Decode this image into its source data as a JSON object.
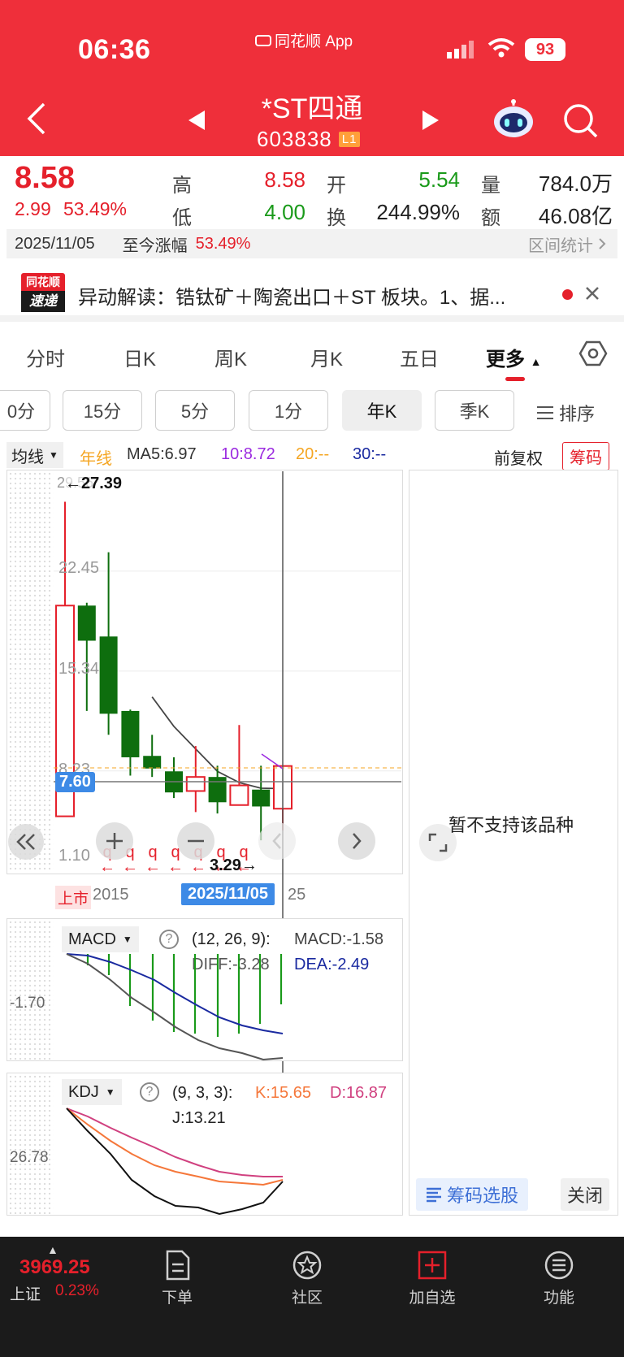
{
  "status": {
    "time": "06:36",
    "app": "同花顺 App",
    "battery": "93"
  },
  "stock": {
    "name": "*ST四通",
    "code": "603838",
    "level": "L1"
  },
  "quote": {
    "price": "8.58",
    "change": "2.99",
    "change_pct": "53.49%",
    "high_label": "高",
    "high": "8.58",
    "low_label": "低",
    "low": "4.00",
    "open_label": "开",
    "open": "5.54",
    "turnover_label": "换",
    "turnover": "244.99%",
    "volume_label": "量",
    "volume": "784.0万",
    "amount_label": "额",
    "amount": "46.08亿"
  },
  "date_bar": {
    "date": "2025/11/05",
    "label": "至今涨幅",
    "value": "53.49%",
    "stats": "区间统计"
  },
  "news": {
    "logo_top": "同花顺",
    "logo_bottom": "速递",
    "text": "异动解读：锆钛矿＋陶瓷出口＋ST 板块。1、据..."
  },
  "tabs": [
    "分时",
    "日K",
    "周K",
    "月K",
    "五日",
    "更多"
  ],
  "intervals": [
    "0分",
    "15分",
    "5分",
    "1分",
    "年K",
    "季K"
  ],
  "sort_label": "排序",
  "ma_bar": {
    "selector": "均线",
    "line": "年线",
    "ma5": "MA5:6.97",
    "ma10": "10:8.72",
    "ma20": "20:--",
    "ma30": "30:--",
    "adj": "前复权",
    "chips": "筹码"
  },
  "chart": {
    "y_labels": [
      "22.45",
      "15.34",
      "8.23",
      "1.10"
    ],
    "y_top": "29.56",
    "high_mark": "←27.39",
    "low_mark": "3.29→",
    "cursor_price": "7.60",
    "x_start_badge": "上市",
    "x_start": "2015",
    "x_cursor": "2025/11/05",
    "x_end": "25",
    "q_mark": "q"
  },
  "chart_data": {
    "type": "candlestick",
    "candles": [
      {
        "open": 5.0,
        "close": 20.0,
        "high": 27.39,
        "low": 5.0,
        "dir": "up"
      },
      {
        "open": 20.0,
        "close": 17.5,
        "high": 20.2,
        "low": 12.5,
        "dir": "down"
      },
      {
        "open": 17.8,
        "close": 12.3,
        "high": 23.8,
        "low": 10.8,
        "dir": "down"
      },
      {
        "open": 12.5,
        "close": 9.2,
        "high": 12.6,
        "low": 7.9,
        "dir": "down"
      },
      {
        "open": 9.3,
        "close": 8.4,
        "high": 10.8,
        "low": 7.8,
        "dir": "down"
      },
      {
        "open": 8.2,
        "close": 6.7,
        "high": 9.2,
        "low": 6.3,
        "dir": "down"
      },
      {
        "open": 6.8,
        "close": 7.8,
        "high": 10.0,
        "low": 5.3,
        "dir": "up"
      },
      {
        "open": 7.8,
        "close": 6.0,
        "high": 8.6,
        "low": 5.2,
        "dir": "down"
      },
      {
        "open": 5.8,
        "close": 7.2,
        "high": 11.5,
        "low": 5.8,
        "dir": "up"
      },
      {
        "open": 6.9,
        "close": 5.7,
        "high": 8.6,
        "low": 3.29,
        "dir": "down"
      },
      {
        "open": 5.54,
        "close": 8.58,
        "high": 8.58,
        "low": 4.0,
        "dir": "up"
      }
    ],
    "ma5": [
      null,
      null,
      null,
      null,
      13.5,
      11.4,
      9.8,
      8.2,
      7.4,
      7.0,
      6.97
    ]
  },
  "right_panel": {
    "message": "暂不支持该品种",
    "filter": "筹码选股",
    "close": "关闭"
  },
  "macd": {
    "label": "MACD",
    "params": "(12, 26, 9):",
    "macd": "MACD:-1.58",
    "diff": "DIFF:-3.28",
    "dea": "DEA:-2.49",
    "axis": "-1.70"
  },
  "kdj": {
    "label": "KDJ",
    "params": "(9, 3, 3):",
    "k": "K:15.65",
    "d": "D:16.87",
    "j": "J:13.21",
    "axis": "26.78"
  },
  "bottom_nav": {
    "index_value": "3969.25",
    "index_name": "上证",
    "index_change": "0.23%",
    "items": [
      "下单",
      "社区",
      "加自选",
      "功能"
    ]
  },
  "colors": {
    "brand_red": "#ef2f3a",
    "up": "#e5202b",
    "down": "#0e6e0e"
  }
}
